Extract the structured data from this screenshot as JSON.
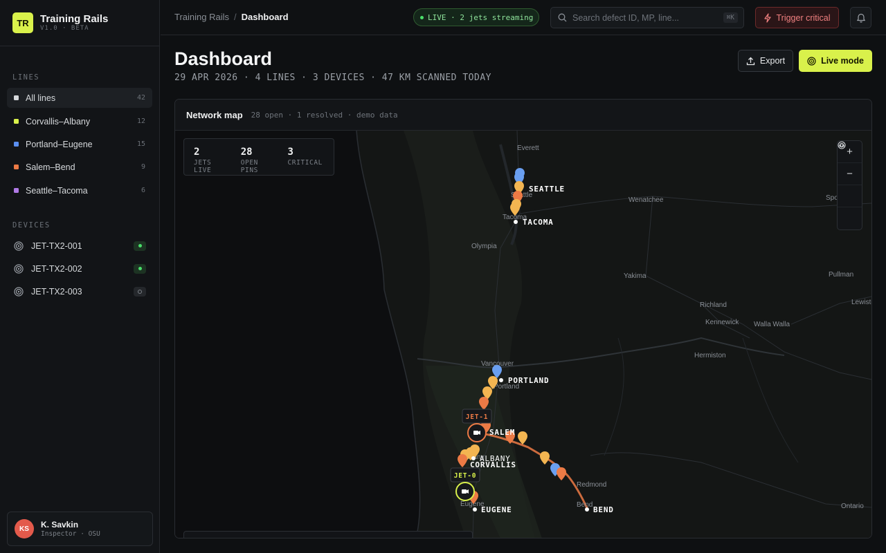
{
  "brand": {
    "logo": "TR",
    "title": "Training Rails",
    "version": "V1.0 · BETA"
  },
  "sidebar": {
    "lines_label": "LINES",
    "lines": [
      {
        "label": "All lines",
        "count": "42",
        "color": "#d6d9dc"
      },
      {
        "label": "Corvallis–Albany",
        "count": "12",
        "color": "#d9f14b"
      },
      {
        "label": "Portland–Eugene",
        "count": "15",
        "color": "#5b8ff0"
      },
      {
        "label": "Salem–Bend",
        "count": "9",
        "color": "#ec7a45"
      },
      {
        "label": "Seattle–Tacoma",
        "count": "6",
        "color": "#b07ae6"
      }
    ],
    "devices_label": "DEVICES",
    "devices": [
      {
        "label": "JET-TX2-001",
        "status": "online"
      },
      {
        "label": "JET-TX2-002",
        "status": "online"
      },
      {
        "label": "JET-TX2-003",
        "status": "offline"
      }
    ]
  },
  "user": {
    "initials": "KS",
    "name": "K. Savkin",
    "role": "Inspector · OSU"
  },
  "topbar": {
    "breadcrumb_root": "Training Rails",
    "breadcrumb_sep": "/",
    "breadcrumb_current": "Dashboard",
    "live_status": "LIVE · 2 jets streaming",
    "search_placeholder": "Search defect ID, MP, line...",
    "search_shortcut": "⌘K",
    "trigger_label": "Trigger critical"
  },
  "page": {
    "title": "Dashboard",
    "subtitle": "29 APR 2026 · 4 LINES · 3 DEVICES · 47 KM SCANNED TODAY",
    "export_label": "Export",
    "live_mode_label": "Live mode"
  },
  "map": {
    "title": "Network map",
    "meta": "28 open · 1 resolved · demo data",
    "stats": [
      {
        "value": "2",
        "label": "JETS LIVE"
      },
      {
        "value": "28",
        "label": "OPEN PINS"
      },
      {
        "value": "3",
        "label": "CRITICAL"
      }
    ],
    "zoom_in": "+",
    "zoom_out": "−",
    "cities": {
      "seattle": "SEATTLE",
      "tacoma": "TACOMA",
      "portland": "PORTLAND",
      "salem": "SALEM",
      "albany": "ALBANY",
      "corvallis": "CORVALLIS",
      "eugene": "EUGENE",
      "bend": "BEND"
    },
    "towns": {
      "everett": "Everett",
      "olympia": "Olympia",
      "wenatchee": "Wenatchee",
      "spokane": "Spokane",
      "yakima": "Yakima",
      "pullman": "Pullman",
      "richland": "Richland",
      "kennewick": "Kennewick",
      "walla_walla": "Walla Walla",
      "lewiston": "Lewiston",
      "hermiston": "Hermiston",
      "vancouver": "Vancouver",
      "redmond": "Redmond",
      "ontario": "Ontario",
      "seattle_small": "Seattle",
      "tacoma_small": "Tacoma",
      "portland_small": "Portland",
      "albany_small": "Albany",
      "eugene_small": "Eugene",
      "bend_small": "Bend"
    },
    "jets": {
      "jet1": "JET-1",
      "jet0": "JET-0"
    },
    "pin_colors": {
      "blue": "#6a9ff0",
      "amber": "#f3b551",
      "orange": "#ec7a45"
    }
  }
}
